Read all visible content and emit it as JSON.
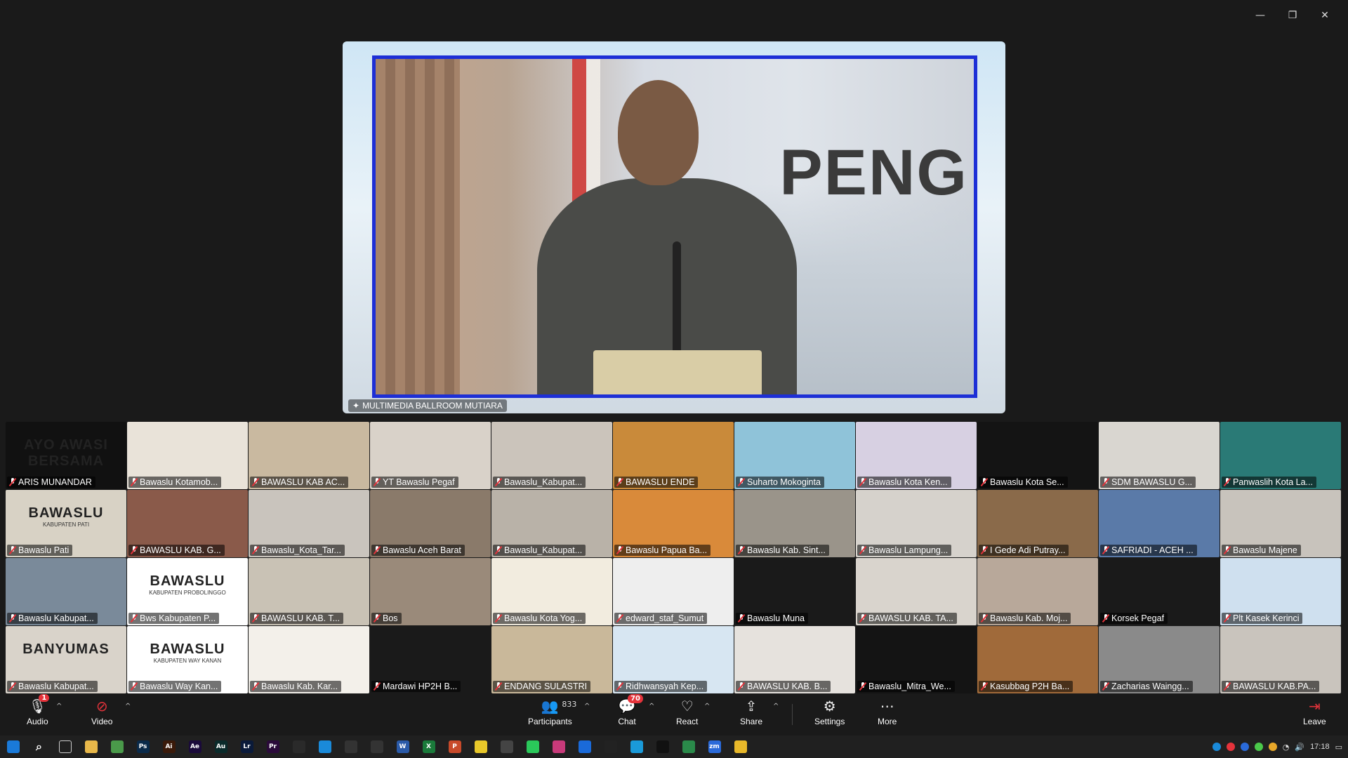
{
  "window": {
    "minimize": "—",
    "maximize": "❐",
    "close": "✕"
  },
  "speaker": {
    "name": "MULTIMEDIA BALLROOM MUTIARA",
    "backdrop_text": "PENG"
  },
  "participants": [
    {
      "name": "ARIS MUNANDAR",
      "bg": "#111111",
      "logo": "AYO AWASI BERSAMA"
    },
    {
      "name": "Bawaslu Kotamob...",
      "bg": "#e9e3d9"
    },
    {
      "name": "BAWASLU KAB AC...",
      "bg": "#c9b9a0"
    },
    {
      "name": "YT Bawaslu Pegaf",
      "bg": "#d9d2c9"
    },
    {
      "name": "Bawaslu_Kabupat...",
      "bg": "#cbc4bb"
    },
    {
      "name": "BAWASLU ENDE",
      "bg": "#c98a3a"
    },
    {
      "name": "Suharto Mokoginta",
      "bg": "#8fc3d9"
    },
    {
      "name": "Bawaslu Kota Ken...",
      "bg": "#d7d0e2"
    },
    {
      "name": "Bawaslu Kota Se...",
      "bg": "#141414"
    },
    {
      "name": "SDM BAWASLU G...",
      "bg": "#d9d6d0"
    },
    {
      "name": "Panwaslih Kota La...",
      "bg": "#2a7a76"
    },
    {
      "name": "Bawaslu Pati",
      "bg": "#d8d2c5",
      "logo": "BAWASLU",
      "logo_sub": "KABUPATEN PATI"
    },
    {
      "name": "BAWASLU KAB. G...",
      "bg": "#8a5a4a"
    },
    {
      "name": "Bawaslu_Kota_Tar...",
      "bg": "#c9c4bd"
    },
    {
      "name": "Bawaslu Aceh Barat",
      "bg": "#8a7a6a"
    },
    {
      "name": "Bawaslu_Kabupat...",
      "bg": "#b9b2a8"
    },
    {
      "name": "Bawaslu Papua Ba...",
      "bg": "#d98a3a"
    },
    {
      "name": "Bawaslu Kab. Sint...",
      "bg": "#9a948a"
    },
    {
      "name": "Bawaslu Lampung...",
      "bg": "#d6d2cc"
    },
    {
      "name": "I Gede Adi Putray...",
      "bg": "#8a6a4a"
    },
    {
      "name": "SAFRIADI - ACEH ...",
      "bg": "#5a7aa8"
    },
    {
      "name": "Bawaslu Majene",
      "bg": "#c8c3bc"
    },
    {
      "name": "Bawaslu Kabupat...",
      "bg": "#7a8a9a"
    },
    {
      "name": "Bws Kabupaten P...",
      "bg": "#ffffff",
      "logo": "BAWASLU",
      "logo_sub": "KABUPATEN PROBOLINGGO"
    },
    {
      "name": "BAWASLU KAB. T...",
      "bg": "#c9c2b5"
    },
    {
      "name": "Bos",
      "bg": "#9a8a7a"
    },
    {
      "name": "Bawaslu Kota Yog...",
      "bg": "#f2ecdf"
    },
    {
      "name": "edward_staf_Sumut",
      "bg": "#eeeeee"
    },
    {
      "name": "Bawaslu Muna",
      "bg": "#1a1a1a"
    },
    {
      "name": "BAWASLU KAB. TA...",
      "bg": "#d9d4cd"
    },
    {
      "name": "Bawaslu Kab. Moj...",
      "bg": "#b8a89a"
    },
    {
      "name": "Korsek Pegaf",
      "bg": "#1a1a1a"
    },
    {
      "name": "Plt Kasek Kerinci",
      "bg": "#cfe0ef"
    },
    {
      "name": "Bawaslu Kabupat...",
      "bg": "#d9d3ca",
      "logo": "BANYUMAS"
    },
    {
      "name": "Bawaslu Way Kan...",
      "bg": "#ffffff",
      "logo": "BAWASLU",
      "logo_sub": "KABUPATEN WAY KANAN"
    },
    {
      "name": "Bawaslu Kab. Kar...",
      "bg": "#f3f0ea"
    },
    {
      "name": "Mardawi HP2H B...",
      "bg": "#1a1a1a"
    },
    {
      "name": "ENDANG SULASTRI",
      "bg": "#c9b89a"
    },
    {
      "name": "Ridhwansyah Kep...",
      "bg": "#d7e6f2"
    },
    {
      "name": "BAWASLU KAB. B...",
      "bg": "#e6e2dd"
    },
    {
      "name": "Bawaslu_Mitra_We...",
      "bg": "#141414"
    },
    {
      "name": "Kasubbag P2H Ba...",
      "bg": "#a06a3a"
    },
    {
      "name": "Zacharias Waingg...",
      "bg": "#8a8a8a"
    },
    {
      "name": "BAWASLU KAB.PA...",
      "bg": "#c9c4bd"
    }
  ],
  "toolbar": {
    "audio": "Audio",
    "video": "Video",
    "participants": "Participants",
    "participants_count": "833",
    "chat": "Chat",
    "chat_badge": "70",
    "react": "React",
    "share": "Share",
    "settings": "Settings",
    "more": "More",
    "leave": "Leave",
    "audio_badge": "1"
  },
  "taskbar": {
    "time": "17:18",
    "apps": [
      {
        "name": "file-explorer-icon",
        "color": "#e8b84a",
        "label": ""
      },
      {
        "name": "chrome-icon",
        "color": "#4a9a4a",
        "label": ""
      },
      {
        "name": "photoshop-icon",
        "color": "#0a2a4a",
        "label": "Ps"
      },
      {
        "name": "illustrator-icon",
        "color": "#3a1a0a",
        "label": "Ai"
      },
      {
        "name": "after-effects-icon",
        "color": "#1a0a3a",
        "label": "Ae"
      },
      {
        "name": "audition-icon",
        "color": "#0a2a2a",
        "label": "Au"
      },
      {
        "name": "lightroom-icon",
        "color": "#0a1a3a",
        "label": "Lr"
      },
      {
        "name": "premiere-icon",
        "color": "#2a0a3a",
        "label": "Pr"
      },
      {
        "name": "app-icon",
        "color": "#2a2a2a",
        "label": ""
      },
      {
        "name": "canva-icon",
        "color": "#1a8ad9",
        "label": ""
      },
      {
        "name": "capcut-icon",
        "color": "#333333",
        "label": ""
      },
      {
        "name": "app2-icon",
        "color": "#333333",
        "label": ""
      },
      {
        "name": "word-icon",
        "color": "#2a5aa8",
        "label": "W"
      },
      {
        "name": "excel-icon",
        "color": "#1a7a3a",
        "label": "X"
      },
      {
        "name": "powerpoint-icon",
        "color": "#c84a2a",
        "label": "P"
      },
      {
        "name": "sticky-notes-icon",
        "color": "#e8c82a",
        "label": ""
      },
      {
        "name": "calculator-icon",
        "color": "#444444",
        "label": ""
      },
      {
        "name": "whatsapp-icon",
        "color": "#2ac85a",
        "label": ""
      },
      {
        "name": "instagram-icon",
        "color": "#c83a7a",
        "label": ""
      },
      {
        "name": "facebook-icon",
        "color": "#1a6ad9",
        "label": ""
      },
      {
        "name": "threads-icon",
        "color": "#222222",
        "label": ""
      },
      {
        "name": "twitter-icon",
        "color": "#1a9ad9",
        "label": ""
      },
      {
        "name": "tiktok-icon",
        "color": "#111111",
        "label": ""
      },
      {
        "name": "app3-icon",
        "color": "#2a8a4a",
        "label": ""
      },
      {
        "name": "zoom-icon",
        "color": "#2a6ad9",
        "label": "zm"
      },
      {
        "name": "drive-icon",
        "color": "#e8b82a",
        "label": ""
      }
    ]
  }
}
